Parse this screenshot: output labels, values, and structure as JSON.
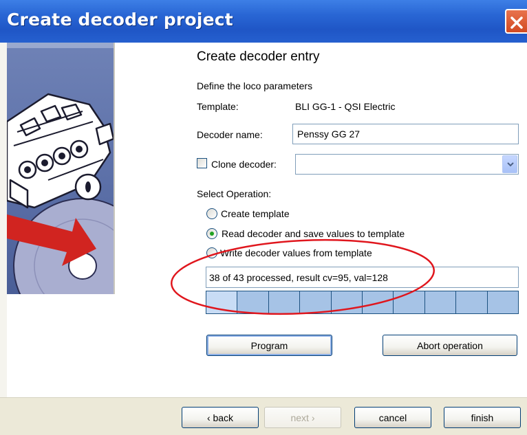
{
  "window": {
    "title": "Create decoder project",
    "close_icon": "close-icon"
  },
  "content": {
    "heading": "Create decoder entry",
    "subtitle": "Define the loco parameters",
    "template_label": "Template:",
    "template_value": "BLI GG-1 - QSI Electric",
    "decoder_name_label": "Decoder name:",
    "decoder_name_value": "Penssy GG 27",
    "clone_label": "Clone decoder:",
    "clone_checked": false,
    "clone_value": "",
    "select_operation_label": "Select Operation:",
    "operations": [
      {
        "label": "Create template",
        "selected": false
      },
      {
        "label": "Read decoder and save values to template",
        "selected": true
      },
      {
        "label": "Write decoder values from template",
        "selected": false
      }
    ],
    "status_text": "38 of 43 processed, result cv=95, val=128",
    "progress": {
      "segments_total": 10,
      "highlighted_segments": 1
    },
    "program_button": "Program",
    "abort_button": "Abort operation"
  },
  "footer": {
    "back_button": "‹ back",
    "next_button": "next ›",
    "cancel_button": "cancel",
    "finish_button": "finish"
  },
  "colors": {
    "titlebar": "#2966d4",
    "close": "#d24a22",
    "annotation": "#e0161d",
    "radio_selected": "#21a121",
    "progress_fill": "#a6c3e6"
  }
}
